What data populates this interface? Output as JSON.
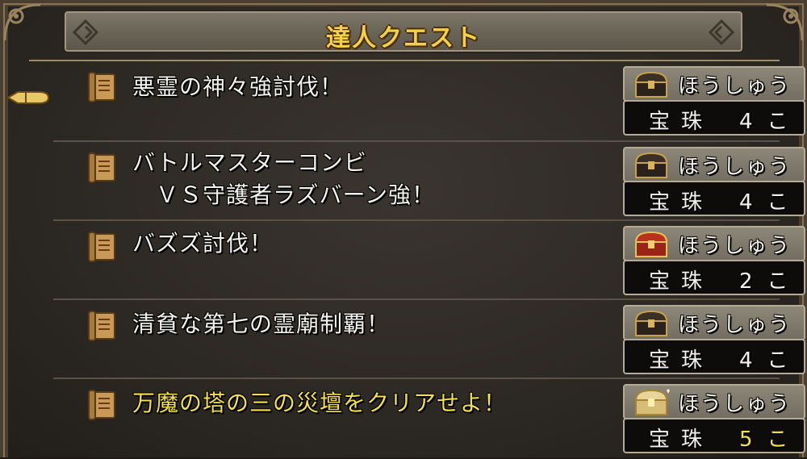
{
  "title": "達人クエスト",
  "reward_header": "ほうしゅう",
  "quests": [
    {
      "title": "悪霊の神々強討伐！",
      "item": "宝珠",
      "count": "4こ",
      "chest": "black",
      "highlight": false
    },
    {
      "title": "バトルマスターコンビ\n　ＶＳ守護者ラズバーン強！",
      "item": "宝珠",
      "count": "4こ",
      "chest": "black",
      "highlight": false
    },
    {
      "title": "バズズ討伐！",
      "item": "宝珠",
      "count": "2こ",
      "chest": "red",
      "highlight": false
    },
    {
      "title": "清貧な第七の霊廟制覇！",
      "item": "宝珠",
      "count": "4こ",
      "chest": "black",
      "highlight": false
    },
    {
      "title": "万魔の塔の三の災壇をクリアせよ！",
      "item": "宝珠",
      "count": "5こ",
      "chest": "gold",
      "highlight": true
    }
  ],
  "colors": {
    "title": "#f5d04a",
    "highlight": "#f3e04a",
    "text": "#f2f2ee"
  },
  "icons": {
    "quest": "scroll-icon",
    "cursor": "hand-cursor-icon",
    "reward": "treasure-chest-icon"
  }
}
